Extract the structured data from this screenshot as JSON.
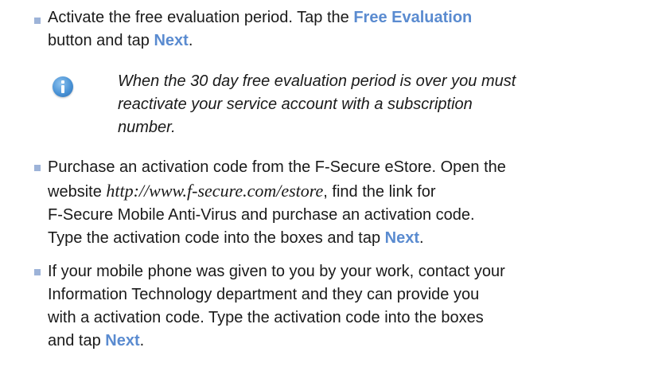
{
  "items": [
    {
      "lines": [
        [
          "Activate the free evaluation period. Tap the ",
          {
            "hl": "Free Evaluation"
          }
        ],
        [
          "button and tap ",
          {
            "hl": "Next"
          },
          "."
        ]
      ]
    },
    {
      "lines": [
        [
          "Purchase an activation code from the F-Secure eStore. Open the"
        ],
        [
          "website ",
          {
            "url": "http://www.f-secure.com/estore"
          },
          ", find the link for"
        ],
        [
          "F-Secure Mobile Anti-Virus and purchase an activation code."
        ],
        [
          "Type the activation code into the boxes and tap ",
          {
            "hl": "Next"
          },
          "."
        ]
      ]
    },
    {
      "lines": [
        [
          "If your mobile phone was given to you by your work, contact your"
        ],
        [
          "Information Technology department and they can provide you"
        ],
        [
          "with a activation code. Type the activation code into the boxes"
        ],
        [
          "and tap ",
          {
            "hl": "Next"
          },
          "."
        ]
      ]
    }
  ],
  "note": {
    "icon": "info-icon",
    "lines": [
      "When the 30 day free evaluation period is over you must",
      "reactivate your service account with a subscription",
      "number."
    ]
  },
  "colors": {
    "highlight": "#5a8bd0",
    "bullet": "#9db3d8",
    "icon": "#4a93d6"
  }
}
